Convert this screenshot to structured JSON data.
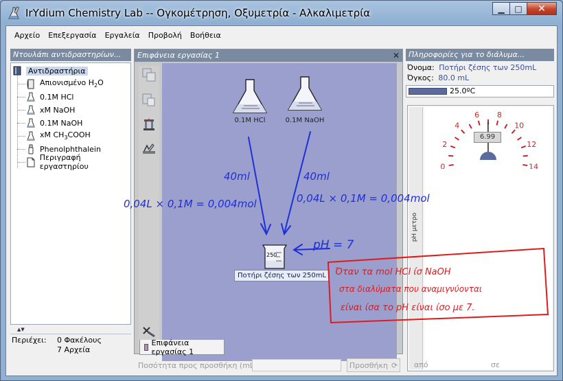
{
  "window": {
    "title": "IrYdium Chemistry Lab -- Ογκομέτρηση, Οξυμετρία - Αλκαλιμετρία",
    "minimize": "▁",
    "maximize": "□",
    "close": "✕"
  },
  "menu": {
    "file": "Αρχείο",
    "edit": "Επεξεργασία",
    "tools": "Εργαλεία",
    "view": "Προβολή",
    "help": "Βοήθεια"
  },
  "stockroom": {
    "header": "Ντουλάπι αντιδραστηρίων...",
    "root": "Αντιδραστήρια",
    "items": [
      {
        "label_main": "Απιονισμένο H",
        "label_sub": "2",
        "label_end": "O",
        "icon": "bottle-icon"
      },
      {
        "label_main": "0.1M HCl",
        "label_sub": "",
        "label_end": "",
        "icon": "flask-icon"
      },
      {
        "label_main": "xM NaOH",
        "label_sub": "",
        "label_end": "",
        "icon": "flask-icon"
      },
      {
        "label_main": "0.1M NaOH",
        "label_sub": "",
        "label_end": "",
        "icon": "flask-icon"
      },
      {
        "label_main": "xM CH",
        "label_sub": "3",
        "label_end": "COOH",
        "icon": "flask-icon"
      },
      {
        "label_main": "Phenolphthalein",
        "label_sub": "",
        "label_end": "",
        "icon": "dropper-bottle-icon"
      },
      {
        "label_main": "Περιγραφή εργαστηρίου",
        "label_sub": "",
        "label_end": "",
        "icon": "document-icon"
      }
    ],
    "contains_label": "Περιέχει:",
    "folders": "0 Φακέλους",
    "files": "7 Αρχεία"
  },
  "workbench": {
    "header": "Επιφάνεια εργασίας 1",
    "tab_label": "Επιφάνεια εργασίας 1",
    "flask1_label": "0.1M HCl",
    "flask2_label": "0.1M NaOH",
    "beaker_label": "Ποτήρι ζέσης των 250mL",
    "beaker_volume_mark": "250"
  },
  "solution_info": {
    "header": "Πληροφορίες για το διάλυμα...",
    "name_label": "Όνομα:",
    "name_value": "Ποτήρι ζέσης των 250mL",
    "volume_label": "Όγκος:",
    "volume_value": "80.0 mL",
    "temperature": "25.0ºC",
    "meter_label": "pH μετρο",
    "ph_reading": "6.99",
    "ph_ticks": [
      "0",
      "2",
      "4",
      "6",
      "8",
      "10",
      "12",
      "14"
    ]
  },
  "bottom": {
    "amount_label": "Ποσότητα προς προσθήκη (mL):",
    "add_button": "Προσθήκη",
    "from_label": "από",
    "to_label": "σε"
  },
  "annotations": {
    "left_volume": "40ml",
    "right_volume": "40ml",
    "left_calc": "0,04L × 0,1M = 0,004mol",
    "right_calc": "0,04L × 0,1M = 0,004mol",
    "ph_note": "pH = 7",
    "box_line1": "Όταν τα mol HCl ίσ NaOH",
    "box_line2": "στα διαλύματα που αναμιγνύονται",
    "box_line3": "είναι ίσα το pH είναι ίσο με 7."
  }
}
